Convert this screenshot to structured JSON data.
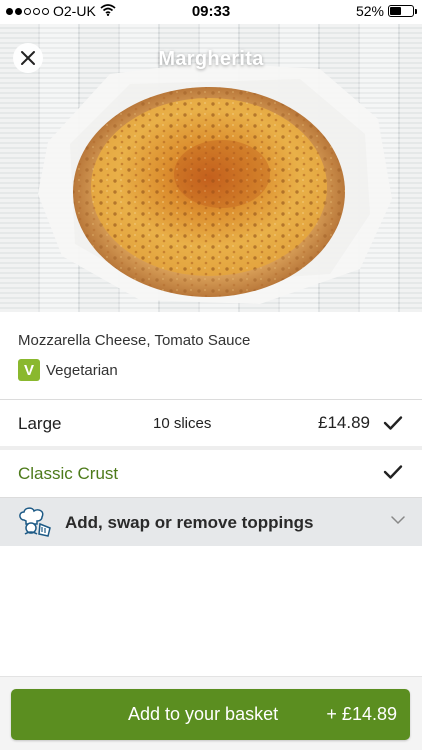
{
  "status_bar": {
    "carrier": "O2-UK",
    "time": "09:33",
    "battery_percent": "52%",
    "battery_level": 0.52,
    "signal_bars_filled": 2,
    "signal_bars_total": 5,
    "icons": [
      "signal-icon",
      "wifi-icon",
      "battery-icon"
    ]
  },
  "header": {
    "title": "Margherita",
    "close_icon": "close-icon"
  },
  "product": {
    "ingredients": "Mozzarella Cheese, Tomato Sauce",
    "dietary_badge": "V",
    "dietary_label": "Vegetarian"
  },
  "size_option": {
    "name": "Large",
    "slices": "10 slices",
    "price": "£14.89",
    "selected": true
  },
  "crust_option": {
    "name": "Classic Crust",
    "selected": true
  },
  "toppings": {
    "label": "Add, swap or remove toppings",
    "icon": "chef-icon",
    "expand_icon": "chevron-down-icon"
  },
  "basket_button": {
    "label": "Add to your basket",
    "price": "+ £14.89"
  },
  "colors": {
    "accent_green": "#5b8e20",
    "crust_text_green": "#4d7a1a",
    "vegetarian_badge": "#8ab82e",
    "toppings_row_bg": "#e6e8ea"
  }
}
